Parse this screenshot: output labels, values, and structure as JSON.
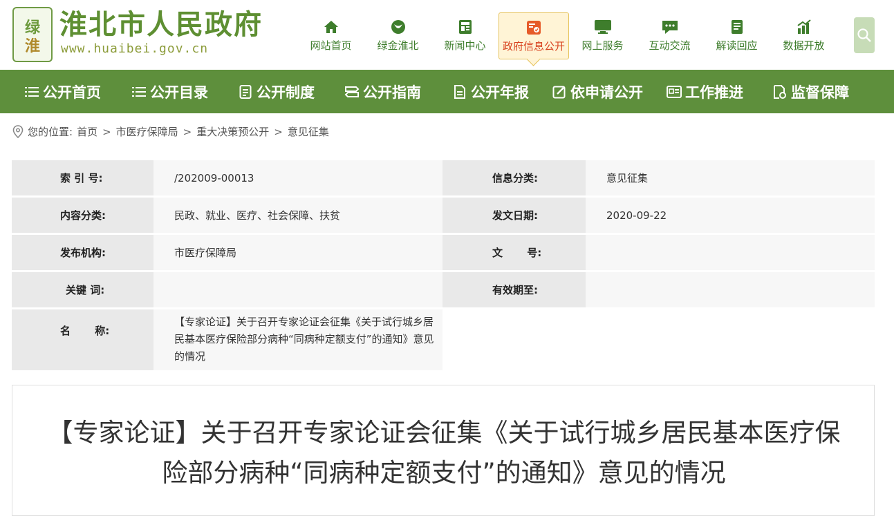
{
  "header": {
    "site_title": "淮北市人民政府",
    "site_url": "www.huaibei.gov.cn",
    "logo_text": "绿金淮北",
    "top_nav": [
      {
        "label": "网站首页",
        "icon": "home-icon"
      },
      {
        "label": "绿金淮北",
        "icon": "leaf-emblem-icon"
      },
      {
        "label": "新闻中心",
        "icon": "news-icon"
      },
      {
        "label": "政府信息公开",
        "icon": "gov-info-icon",
        "active": true
      },
      {
        "label": "网上服务",
        "icon": "monitor-icon"
      },
      {
        "label": "互动交流",
        "icon": "chat-icon"
      },
      {
        "label": "解读回应",
        "icon": "book-icon"
      },
      {
        "label": "数据开放",
        "icon": "chart-icon"
      }
    ],
    "search_icon": "search-icon"
  },
  "main_nav": [
    {
      "label": "公开首页",
      "icon": "list-icon"
    },
    {
      "label": "公开目录",
      "icon": "list-icon"
    },
    {
      "label": "公开制度",
      "icon": "document-icon"
    },
    {
      "label": "公开指南",
      "icon": "signpost-icon"
    },
    {
      "label": "公开年报",
      "icon": "report-icon"
    },
    {
      "label": "依申请公开",
      "icon": "edit-icon"
    },
    {
      "label": "工作推进",
      "icon": "card-icon"
    },
    {
      "label": "监督保障",
      "icon": "shield-doc-icon"
    }
  ],
  "breadcrumb": {
    "prefix": "您的位置:",
    "items": [
      "首页",
      "市医疗保障局",
      "重大决策预公开",
      "意见征集"
    ]
  },
  "info": {
    "index_label": "索 引 号:",
    "index_value": "/202009-00013",
    "category_label": "信息分类:",
    "category_value": "意见征集",
    "content_label": "内容分类:",
    "content_value": "民政、就业、医疗、社会保障、扶贫",
    "date_label": "发文日期:",
    "date_value": "2020-09-22",
    "org_label": "发布机构:",
    "org_value": "市医疗保障局",
    "docno_label": "文 号:",
    "docno_value": "",
    "keyword_label": "关键 词:",
    "keyword_value": "",
    "valid_label": "有效期至:",
    "valid_value": "",
    "name_label": "名 称:",
    "name_value": "【专家论证】关于召开专家论证会征集《关于试行城乡居民基本医疗保险部分病种“同病种定额支付”的通知》意见的情况"
  },
  "article": {
    "title": "【专家论证】关于召开专家论证会征集《关于试行城乡居民基本医疗保险部分病种“同病种定额支付”的通知》意见的情况"
  },
  "colors": {
    "brand_green": "#5e8f3c",
    "active_red": "#d8421e",
    "active_bg": "#fff4d6"
  }
}
